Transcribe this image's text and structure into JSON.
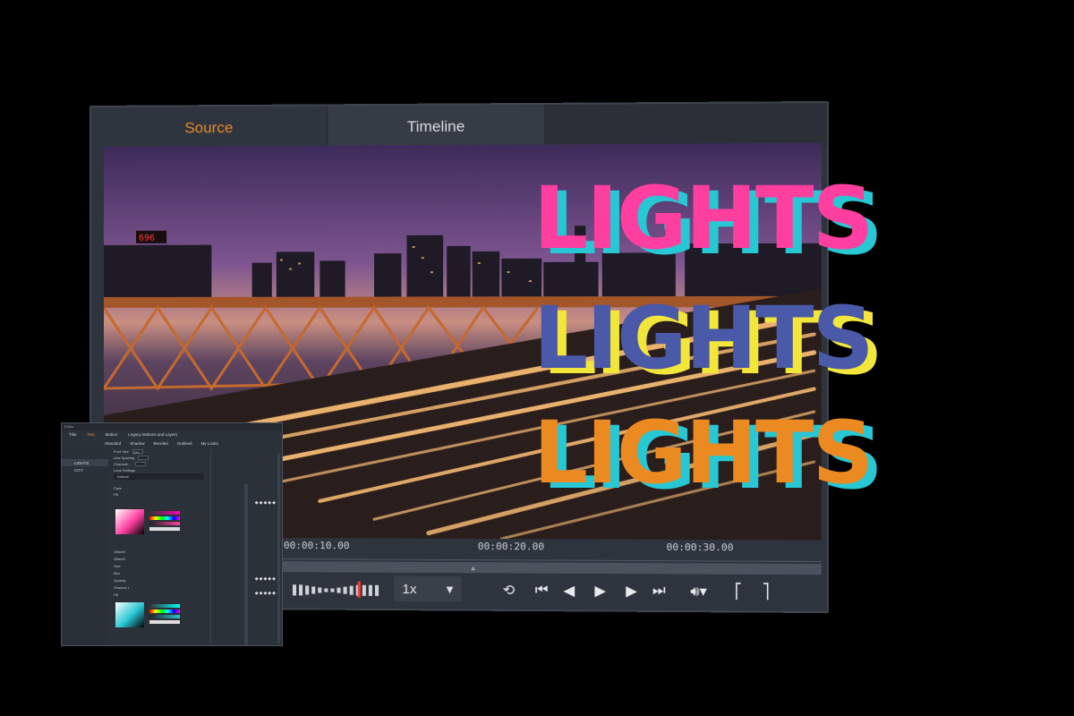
{
  "player": {
    "tabs": {
      "source": "Source",
      "timeline": "Timeline"
    },
    "ruler": {
      "t1": "00:00:10.00",
      "t2": "00:00:20.00",
      "t3": "00:00:30.00"
    },
    "speed": {
      "value": "1x"
    },
    "sign": "696"
  },
  "overlay": {
    "line1": "LIGHTS",
    "line2": "LIGHTS",
    "line3": "LIGHTS"
  },
  "editor": {
    "window_title": "Editor",
    "tabs": [
      "Title",
      "Text",
      "Motion",
      "Legacy Motions and Layers"
    ],
    "active_tab": "Text",
    "looks": [
      "Standard",
      "Shadow",
      "Beveled",
      "Outlined",
      "My Looks"
    ],
    "layers": [
      "LIGHTS",
      "CITY"
    ],
    "props": {
      "font_size": "Font Size",
      "font_size_val": "220",
      "line_spacing": "Line Spacing",
      "character": "Characte...",
      "look_settings": "Look Settings",
      "default": "Default",
      "face": "Face",
      "fill": "Fill",
      "offset_x": "OffsetX",
      "offset_y": "OffsetY",
      "size": "Size",
      "blur": "Blur",
      "opacity": "Opacity",
      "shadow1": "Shadow 1",
      "fill2": "Fill"
    }
  },
  "colors": {
    "accent": "#e8892c",
    "pink": "#ff3fa0",
    "cyan": "#27c7d4",
    "blue": "#4a59a8",
    "yellow": "#f2e63a",
    "orange": "#ec8a22"
  }
}
